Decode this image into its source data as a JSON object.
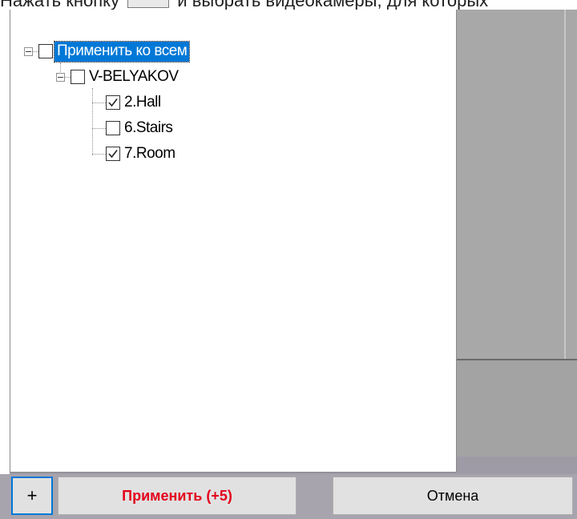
{
  "caption": {
    "text_before": "Нажать кнопку",
    "text_after": "и выбрать видеокамеры, для которых"
  },
  "tree": {
    "root": {
      "label": "Применить ко всем",
      "checked": false,
      "expanded": true,
      "selected": true
    },
    "server": {
      "label": "V-BELYAKOV",
      "checked": false,
      "expanded": true
    },
    "cameras": [
      {
        "label": "2.Hall",
        "checked": true
      },
      {
        "label": "6.Stairs",
        "checked": false
      },
      {
        "label": "7.Room",
        "checked": true
      }
    ]
  },
  "buttons": {
    "add_label": "+",
    "apply_label": "Применить (+5)",
    "cancel_label": "Отмена"
  },
  "colors": {
    "selection": "#0078d7",
    "apply_text": "#e3001b",
    "background": "#9e9aa6"
  }
}
